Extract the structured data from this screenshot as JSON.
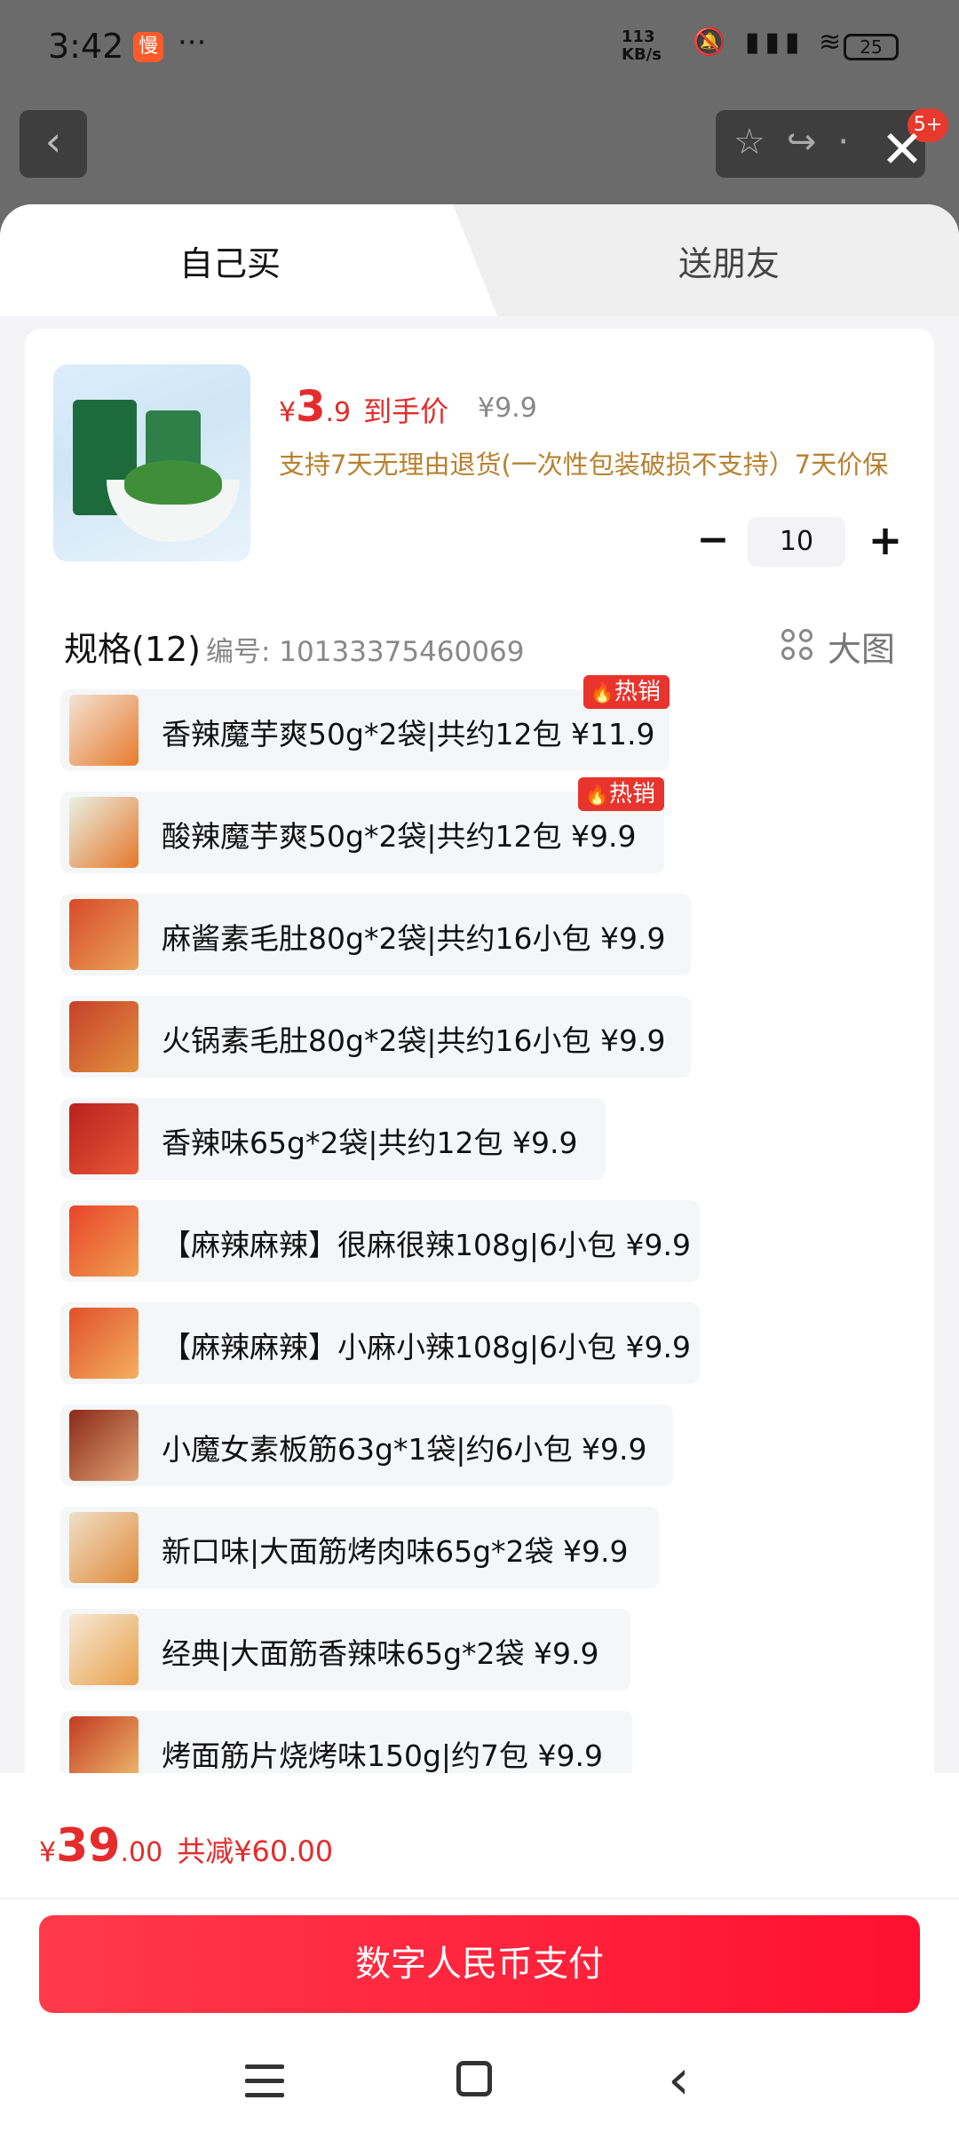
{
  "status_bar": {
    "time": "3:42",
    "app_badge": "慢",
    "dots": "···",
    "speed_top": "113",
    "speed_bottom": "KB/s",
    "battery": "25"
  },
  "tabs": {
    "self_buy": "自己买",
    "gift": "送朋友"
  },
  "product": {
    "price_symbol": "¥",
    "price_int": "3",
    "price_dec": ".9",
    "price_tag": "到手价",
    "original_price": "¥9.9",
    "guarantee": "支持7天无理由退货(一次性包装破损不支持）7天价保",
    "quantity": "10"
  },
  "specs": {
    "title": "规格(12)",
    "code": "编号: 10133375460069",
    "big_image_label": "大图",
    "hot_label": "热销",
    "items": [
      {
        "label": "香辣魔芋爽50g*2袋|共约12包 ¥11.9",
        "hot": true
      },
      {
        "label": "酸辣魔芋爽50g*2袋|共约12包 ¥9.9",
        "hot": true
      },
      {
        "label": "麻酱素毛肚80g*2袋|共约16小包 ¥9.9",
        "hot": false
      },
      {
        "label": "火锅素毛肚80g*2袋|共约16小包 ¥9.9",
        "hot": false
      },
      {
        "label": "香辣味65g*2袋|共约12包 ¥9.9",
        "hot": false
      },
      {
        "label": "【麻辣麻辣】很麻很辣108g|6小包 ¥9.9",
        "hot": false
      },
      {
        "label": "【麻辣麻辣】小麻小辣108g|6小包 ¥9.9",
        "hot": false
      },
      {
        "label": "小魔女素板筋63g*1袋|约6小包 ¥9.9",
        "hot": false
      },
      {
        "label": "新口味|大面筋烤肉味65g*2袋 ¥9.9",
        "hot": false
      },
      {
        "label": "经典|大面筋香辣味65g*2袋 ¥9.9",
        "hot": false
      },
      {
        "label": "烤面筋片烧烤味150g|约7包 ¥9.9",
        "hot": false
      }
    ]
  },
  "footer": {
    "total_symbol": "¥",
    "total_int": "39",
    "total_dec": ".00",
    "savings": "共减¥60.00",
    "pay_button": "数字人民币支付"
  },
  "background": {
    "badge": "5+"
  },
  "colors": {
    "accent_red": "#e52b2b",
    "pay_gradient_start": "#ff3a4a",
    "pay_gradient_end": "#ff1030",
    "guarantee_gold": "#b8812f"
  }
}
